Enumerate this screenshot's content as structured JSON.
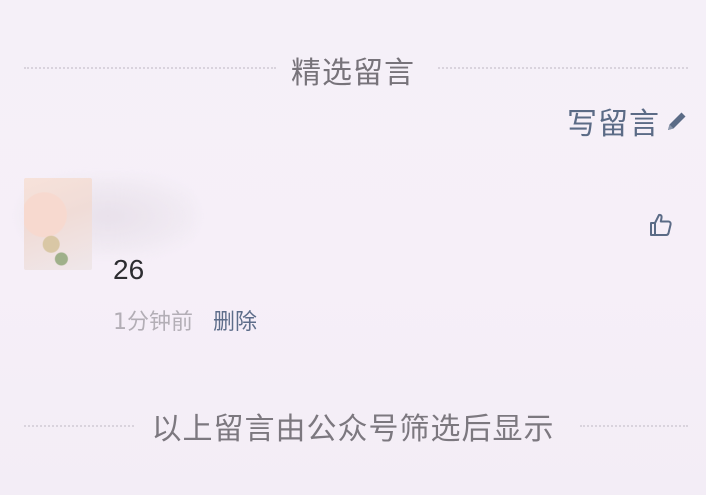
{
  "section_title": "精选留言",
  "write_comment": {
    "label": "写留言",
    "icon": "pencil-icon"
  },
  "comment": {
    "text": "26",
    "time": "1分钟前",
    "delete_label": "删除",
    "like_icon": "thumbs-up-icon"
  },
  "footer_note": "以上留言由公众号筛选后显示",
  "colors": {
    "link": "#5b6b86",
    "muted": "#b3aeb6",
    "text": "#2d2d31",
    "background": "#f5f0f8"
  }
}
